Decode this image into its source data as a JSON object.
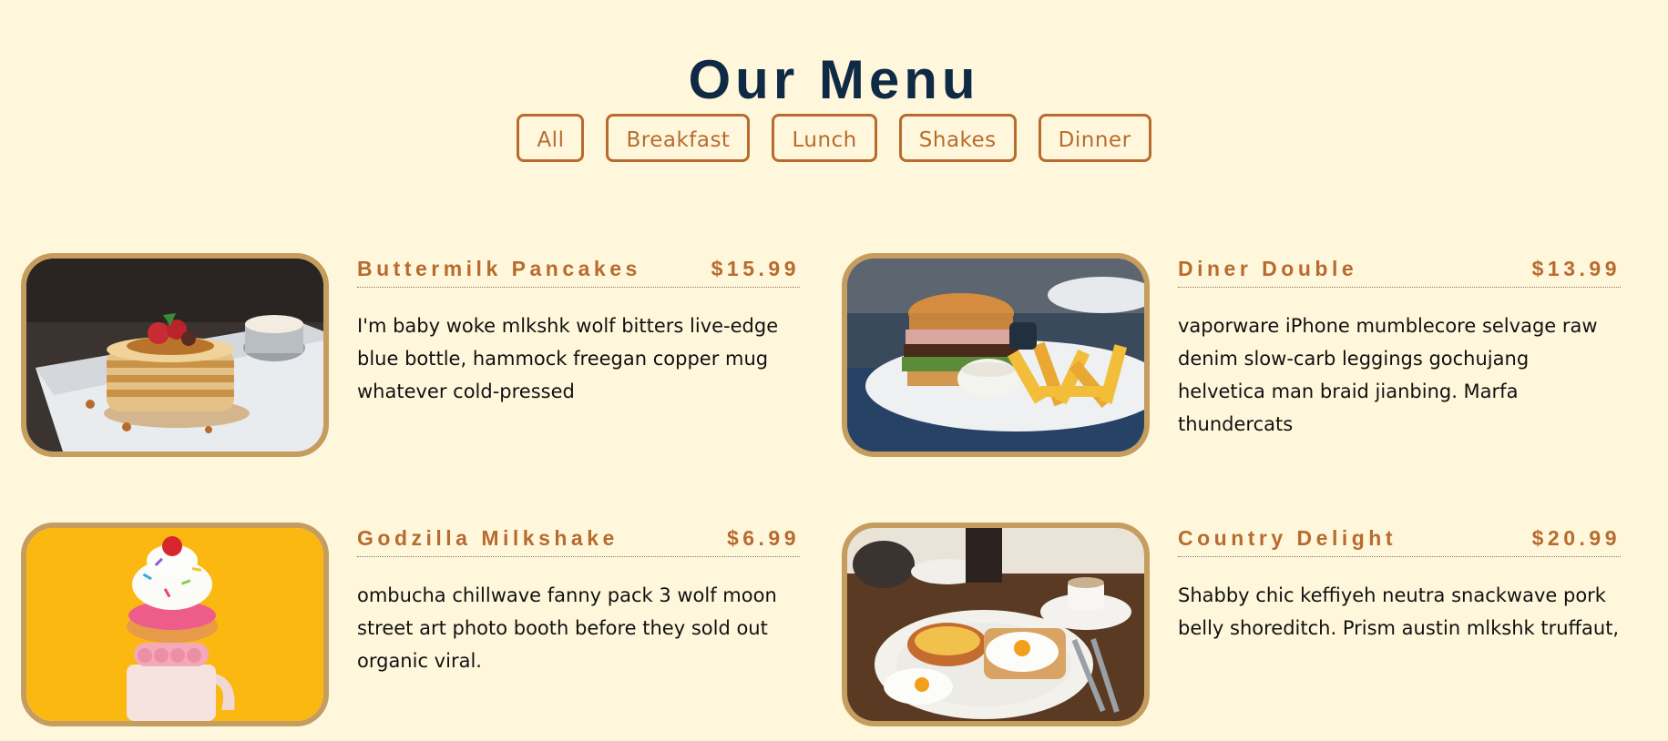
{
  "page": {
    "title": "Our Menu"
  },
  "filters": [
    "All",
    "Breakfast",
    "Lunch",
    "Shakes",
    "Dinner"
  ],
  "items": [
    {
      "name": "Buttermilk Pancakes",
      "price": "$15.99",
      "description": "I'm baby woke mlkshk wolf bitters live-edge blue bottle, hammock freegan copper mug whatever cold-pressed"
    },
    {
      "name": "Diner Double",
      "price": "$13.99",
      "description": "vaporware iPhone mumblecore selvage raw denim slow-carb leggings gochujang helvetica man braid jianbing. Marfa thundercats"
    },
    {
      "name": "Godzilla Milkshake",
      "price": "$6.99",
      "description": "ombucha chillwave fanny pack 3 wolf moon street art photo booth before they sold out organic viral."
    },
    {
      "name": "Country Delight",
      "price": "$20.99",
      "description": "Shabby chic keffiyeh neutra snackwave pork belly shoreditch. Prism austin mlkshk truffaut,"
    }
  ],
  "colors": {
    "background": "#fff7dc",
    "title": "#0f2a45",
    "accent": "#b86b2e",
    "photo_border": "#c59d5f"
  }
}
